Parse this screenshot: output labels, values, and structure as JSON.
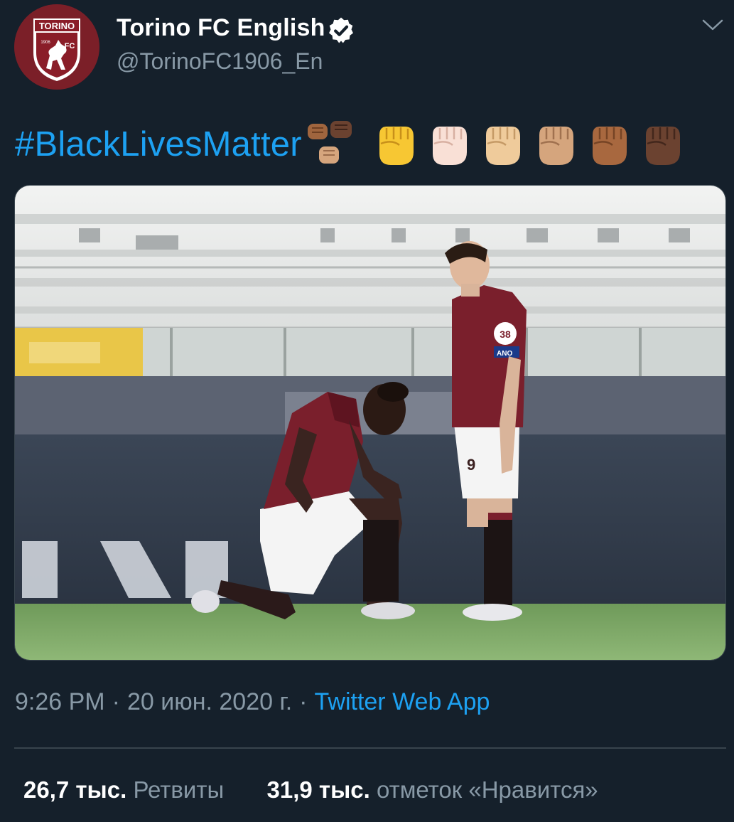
{
  "account": {
    "display_name": "Torino FC English",
    "handle": "@TorinoFC1906_En",
    "avatar": {
      "icon": "torino-fc-crest",
      "crest_text": "TORINO",
      "crest_year": "1906",
      "crest_fc": "FC"
    },
    "verified_icon": "verified-badge-icon",
    "menu_icon": "chevron-down-icon"
  },
  "tweet": {
    "hashtag": "#BlackLivesMatter",
    "emojis": [
      {
        "name": "multiple-raised-fists-emoji",
        "skin": "#a0653e"
      },
      {
        "name": "raised-fist-emoji",
        "skin": "#f7c733"
      },
      {
        "name": "raised-fist-light-emoji",
        "skin": "#f9e0d6"
      },
      {
        "name": "raised-fist-medium-light-emoji",
        "skin": "#efcb9b"
      },
      {
        "name": "raised-fist-medium-emoji",
        "skin": "#d5a57d"
      },
      {
        "name": "raised-fist-medium-dark-emoji",
        "skin": "#a8683f"
      },
      {
        "name": "raised-fist-dark-emoji",
        "skin": "#6b4230"
      }
    ],
    "photo": {
      "shirt_number": "38",
      "captain_band": "ANO",
      "shorts_number": "9"
    }
  },
  "meta": {
    "time": "9:26 PM",
    "separator": "·",
    "date": "20 июн. 2020 г.",
    "source": "Twitter Web App"
  },
  "stats": {
    "retweets_count": "26,7 тыс.",
    "retweets_label": "Ретвиты",
    "likes_count": "31,9 тыс.",
    "likes_label": "отметок «Нравится»"
  },
  "colors": {
    "background": "#15202b",
    "link": "#1da1f2",
    "muted": "#8899a6",
    "divider": "#38444d"
  }
}
